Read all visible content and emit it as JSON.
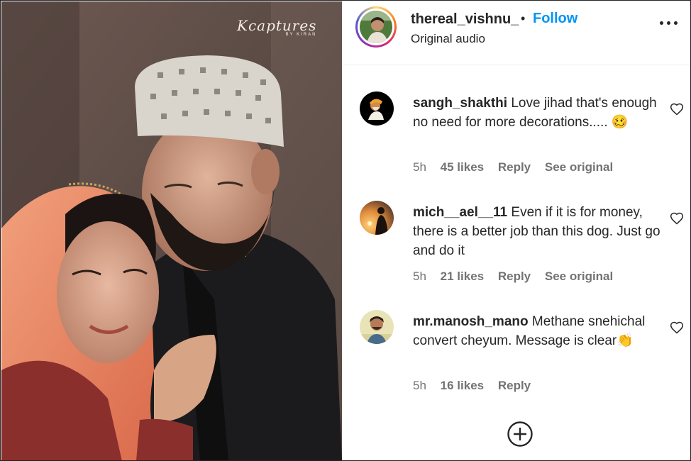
{
  "post": {
    "watermark": "Kcaptures",
    "watermark_sub": "BY KIRAN",
    "username": "thereal_vishnu_",
    "separator": "•",
    "follow_label": "Follow",
    "audio_label": "Original audio"
  },
  "comments": [
    {
      "username": "sangh_shakthi",
      "text": "Love jihad that's enough no need for more decorations.....",
      "emoji": "🥴",
      "time": "5h",
      "likes": "45 likes",
      "reply": "Reply",
      "see_original": "See original"
    },
    {
      "username": "mich__ael__11",
      "text": "Even if it is for money, there is a better job than this dog. Just go and do it",
      "emoji": "",
      "time": "5h",
      "likes": "21 likes",
      "reply": "Reply",
      "see_original": "See original"
    },
    {
      "username": "mr.manosh_mano",
      "text": "Methane snehichal convert cheyum. Message is clear",
      "emoji": "👏",
      "time": "5h",
      "likes": "16 likes",
      "reply": "Reply",
      "see_original": ""
    }
  ],
  "colors": {
    "accent": "#0095f6",
    "meta": "#737373",
    "text": "#262626"
  },
  "icons": {
    "more": "more-options-icon",
    "heart": "heart-icon",
    "add": "add-comment-icon"
  }
}
